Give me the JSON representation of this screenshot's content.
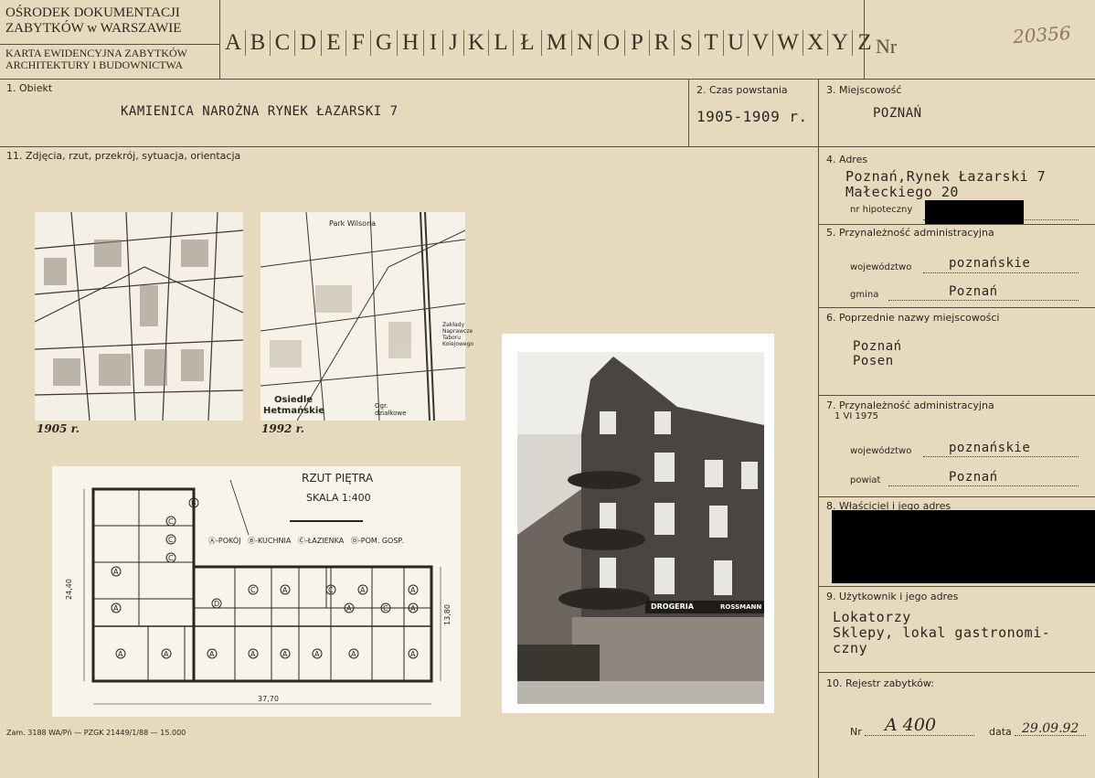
{
  "header": {
    "org_line1": "OŚRODEK DOKUMENTACJI",
    "org_line2": "ZABYTKÓW w WARSZAWIE",
    "card_line1": "KARTA EWIDENCYJNA ZABYTKÓW",
    "card_line2": "ARCHITEKTURY I BUDOWNICTWA",
    "alphabet": [
      "A",
      "B",
      "C",
      "D",
      "E",
      "F",
      "G",
      "H",
      "I",
      "J",
      "K",
      "L",
      "Ł",
      "M",
      "N",
      "O",
      "P",
      "R",
      "S",
      "T",
      "U",
      "V",
      "W",
      "X",
      "Y",
      "Z"
    ],
    "nr_label": "Nr",
    "nr_value": "20356"
  },
  "obiekt": {
    "label": "1. Obiekt",
    "value": "KAMIENICA NAROŻNA RYNEK ŁAZARSKI 7"
  },
  "czas": {
    "label": "2. Czas powstania",
    "value": "1905-1909 r."
  },
  "miejscowosc": {
    "label": "3. Miejscowość",
    "value": "POZNAŃ"
  },
  "zdjecia": {
    "label": "11. Zdjęcia, rzut, przekrój, sytuacja, orientacja"
  },
  "maps": {
    "map1_year": "1905 r.",
    "map2_year": "1992 r.",
    "map2_labels": [
      "Park Wilsona",
      "Osiedle",
      "Hetmańskie",
      "Zakłady Naprawcze Taboru Kolejowego",
      "Ogr. działkowe"
    ]
  },
  "plan": {
    "title": "RZUT PIĘTRA",
    "scale": "SKALA 1:400",
    "legend": "Ⓐ-POKÓJ   Ⓑ-KUCHNIA   Ⓒ-ŁAZIENKA   Ⓓ-POM. GOSP.",
    "dim_width": "37,70",
    "dim_height": "24,40",
    "dim_right": "13,80",
    "rooms_top": [
      "B",
      "C",
      "C",
      "A",
      "C",
      "D",
      "C",
      "A",
      "A",
      "A",
      "C",
      "A",
      "C",
      "A",
      "A"
    ],
    "rooms_bottom": [
      "A",
      "A",
      "A",
      "A",
      "A",
      "A",
      "A",
      "A"
    ]
  },
  "adres": {
    "label": "4. Adres",
    "line1": "Poznań,Rynek Łazarski 7",
    "line2": "Małeckiego 20",
    "hipoteczny_label": "nr hipoteczny"
  },
  "przynaleznosc": {
    "label": "5. Przynależność administracyjna",
    "woj_label": "województwo",
    "woj_value": "poznańskie",
    "gmina_label": "gmina",
    "gmina_value": "Poznań"
  },
  "poprzednie": {
    "label": "6. Poprzednie nazwy miejscowości",
    "line1": "Poznań",
    "line2": "Posen"
  },
  "przynaleznosc1975": {
    "label": "7. Przynależność administracyjna",
    "date": "1 VI 1975",
    "woj_label": "województwo",
    "woj_value": "poznańskie",
    "powiat_label": "powiat",
    "powiat_value": "Poznań"
  },
  "wlasciciel": {
    "label": "8. Właściciel i jego adres"
  },
  "uzytkownik": {
    "label": "9. Użytkownik i jego adres",
    "line1": "Lokatorzy",
    "line2": "Sklepy, lokal gastronomi-",
    "line3": "czny"
  },
  "rejestr": {
    "label": "10. Rejestr zabytków:",
    "nr_label": "Nr",
    "nr_value": "A 400",
    "data_label": "data",
    "data_value": "29.09.92"
  },
  "footer": {
    "print_note": "Zam. 3188 WA/Pń — PZGK 21449/1/88 — 15.000"
  },
  "photo": {
    "shop_sign1": "DROGERIA",
    "shop_sign2": "ROSSMANN"
  },
  "colors": {
    "paper": "#e7d9bd",
    "ink": "#2a2620",
    "lines": "#5b4f40"
  }
}
